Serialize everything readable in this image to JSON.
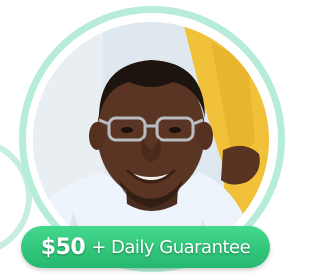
{
  "badge": {
    "amount": "$50",
    "text": "+ Daily Guarantee"
  },
  "colors": {
    "ring": "#b6ecd8",
    "badge_green": "#2fc67a",
    "shirt": "#eef4fb",
    "yellow_dress": "#f2c13a"
  }
}
